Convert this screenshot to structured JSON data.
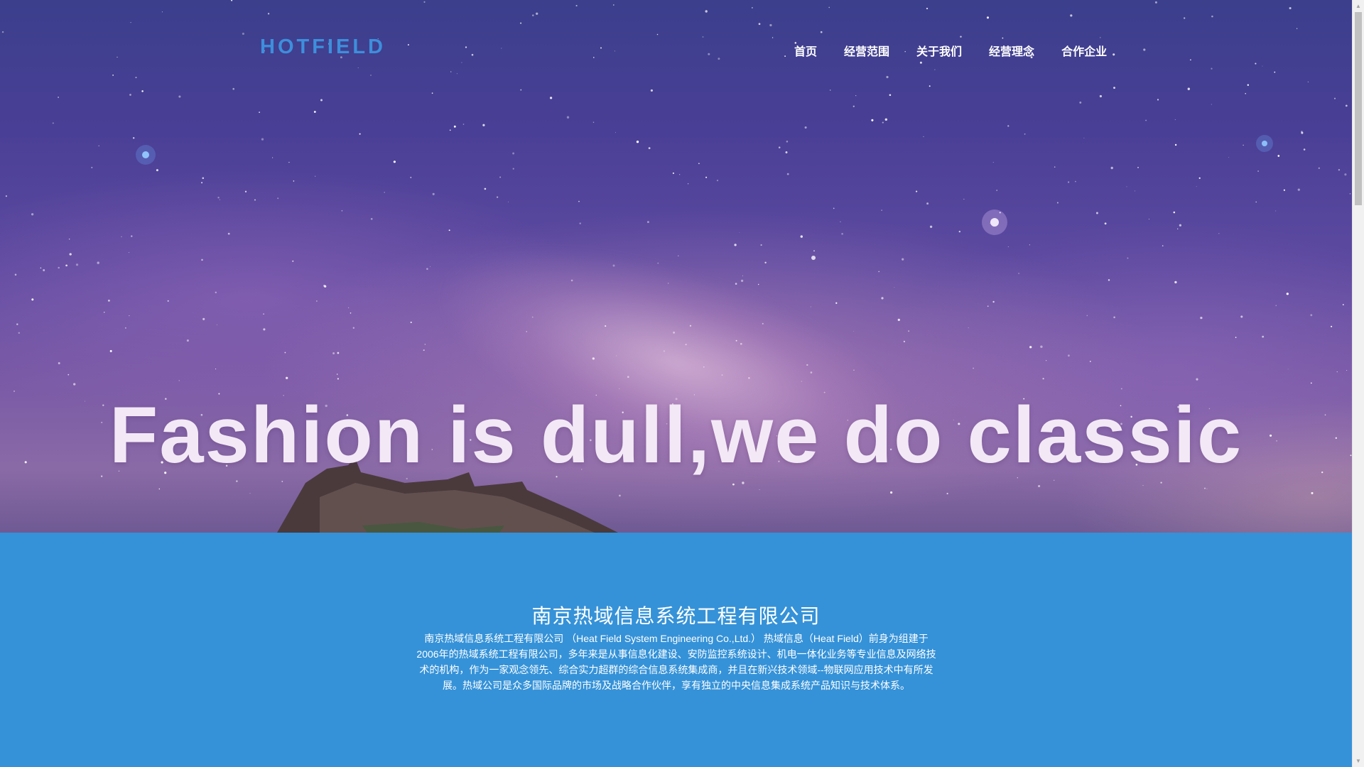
{
  "header": {
    "logo": "HOTFIELD",
    "nav": [
      {
        "label": "首页"
      },
      {
        "label": "经营范围"
      },
      {
        "label": "关于我们"
      },
      {
        "label": "经营理念"
      },
      {
        "label": "合作企业"
      }
    ]
  },
  "hero": {
    "headline": "Fashion is dull,we do classic"
  },
  "about": {
    "title": "南京热域信息系统工程有限公司",
    "text": "南京热域信息系统工程有限公司 （Heat Field System Engineering Co.,Ltd.） 热域信息（Heat Field）前身为组建于2006年的热域系统工程有限公司，多年来是从事信息化建设、安防监控系统设计、机电一体化业务等专业信息及网络技术的机构，作为一家观念领先、综合实力超群的综合信息系统集成商，并且在新兴技术领域--物联网应用技术中有所发展。热域公司是众多国际品牌的市场及战略合作伙伴，享有独立的中央信息集成系统产品知识与技术体系。"
  },
  "colors": {
    "logo": "#3d8fdc",
    "about_bg": "#3592d8",
    "headline": "#f3e9f6"
  },
  "icons": {
    "scroll_up": "triangle-up",
    "scroll_down": "triangle-down"
  }
}
